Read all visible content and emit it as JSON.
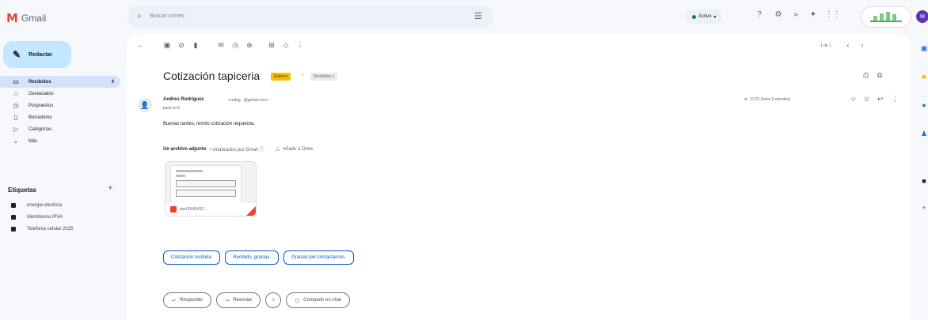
{
  "app": {
    "logo_letter": "M",
    "name": "Gmail",
    "search_placeholder": "Buscar correo",
    "status_label": "Activo",
    "avatar_letter": "M"
  },
  "sidebar": {
    "compose_label": "Redactar",
    "items": [
      {
        "label": "Recibidos",
        "count": "4",
        "icon": "inbox-icon",
        "active": true
      },
      {
        "label": "Destacados",
        "icon": "star-icon"
      },
      {
        "label": "Pospuestos",
        "icon": "clock-icon"
      },
      {
        "label": "Borradores",
        "icon": "draft-icon"
      },
      {
        "label": "Categorías",
        "icon": "label-icon"
      },
      {
        "label": "Más",
        "icon": "chevron-down-icon"
      }
    ],
    "labels_title": "Etiquetas",
    "labels": [
      {
        "label": "energia electrica"
      },
      {
        "label": "Membresía IPVA"
      },
      {
        "label": "Telefonia celular 2025"
      }
    ]
  },
  "toolbar": {
    "pager": "1 de 1"
  },
  "email": {
    "subject": "Cotización tapiceria",
    "external_badge": "Externo",
    "folder_badge": "Recibidos ×",
    "sender_name": "Andres Rodriguez",
    "sender_email": "<rodrig...@gmail.com>",
    "to_line": "para mí ▾",
    "time": "12:11 (hace 6 minutos)",
    "body": "Buenas tardes, remito cotización requerida.",
    "attachments_title": "Un archivo adjunto",
    "attachments_scan": "• Analizados por Gmail ⓘ",
    "add_to_drive": "Añadir a Drive",
    "attachment_name": "doc00345432..."
  },
  "smart_replies": [
    "Cotización recibida.",
    "Recibido, gracias.",
    "Gracias por contactarnos."
  ],
  "actions": {
    "reply": "Responder",
    "forward": "Reenviar",
    "share_chat": "Compartir en chat"
  },
  "colors": {
    "compose_bg": "#c2e7ff",
    "active_bg": "#d3e3fd",
    "external_badge": "#fbbc04",
    "chip_blue": "#0b57d0",
    "avatar": "#5e35b1"
  }
}
